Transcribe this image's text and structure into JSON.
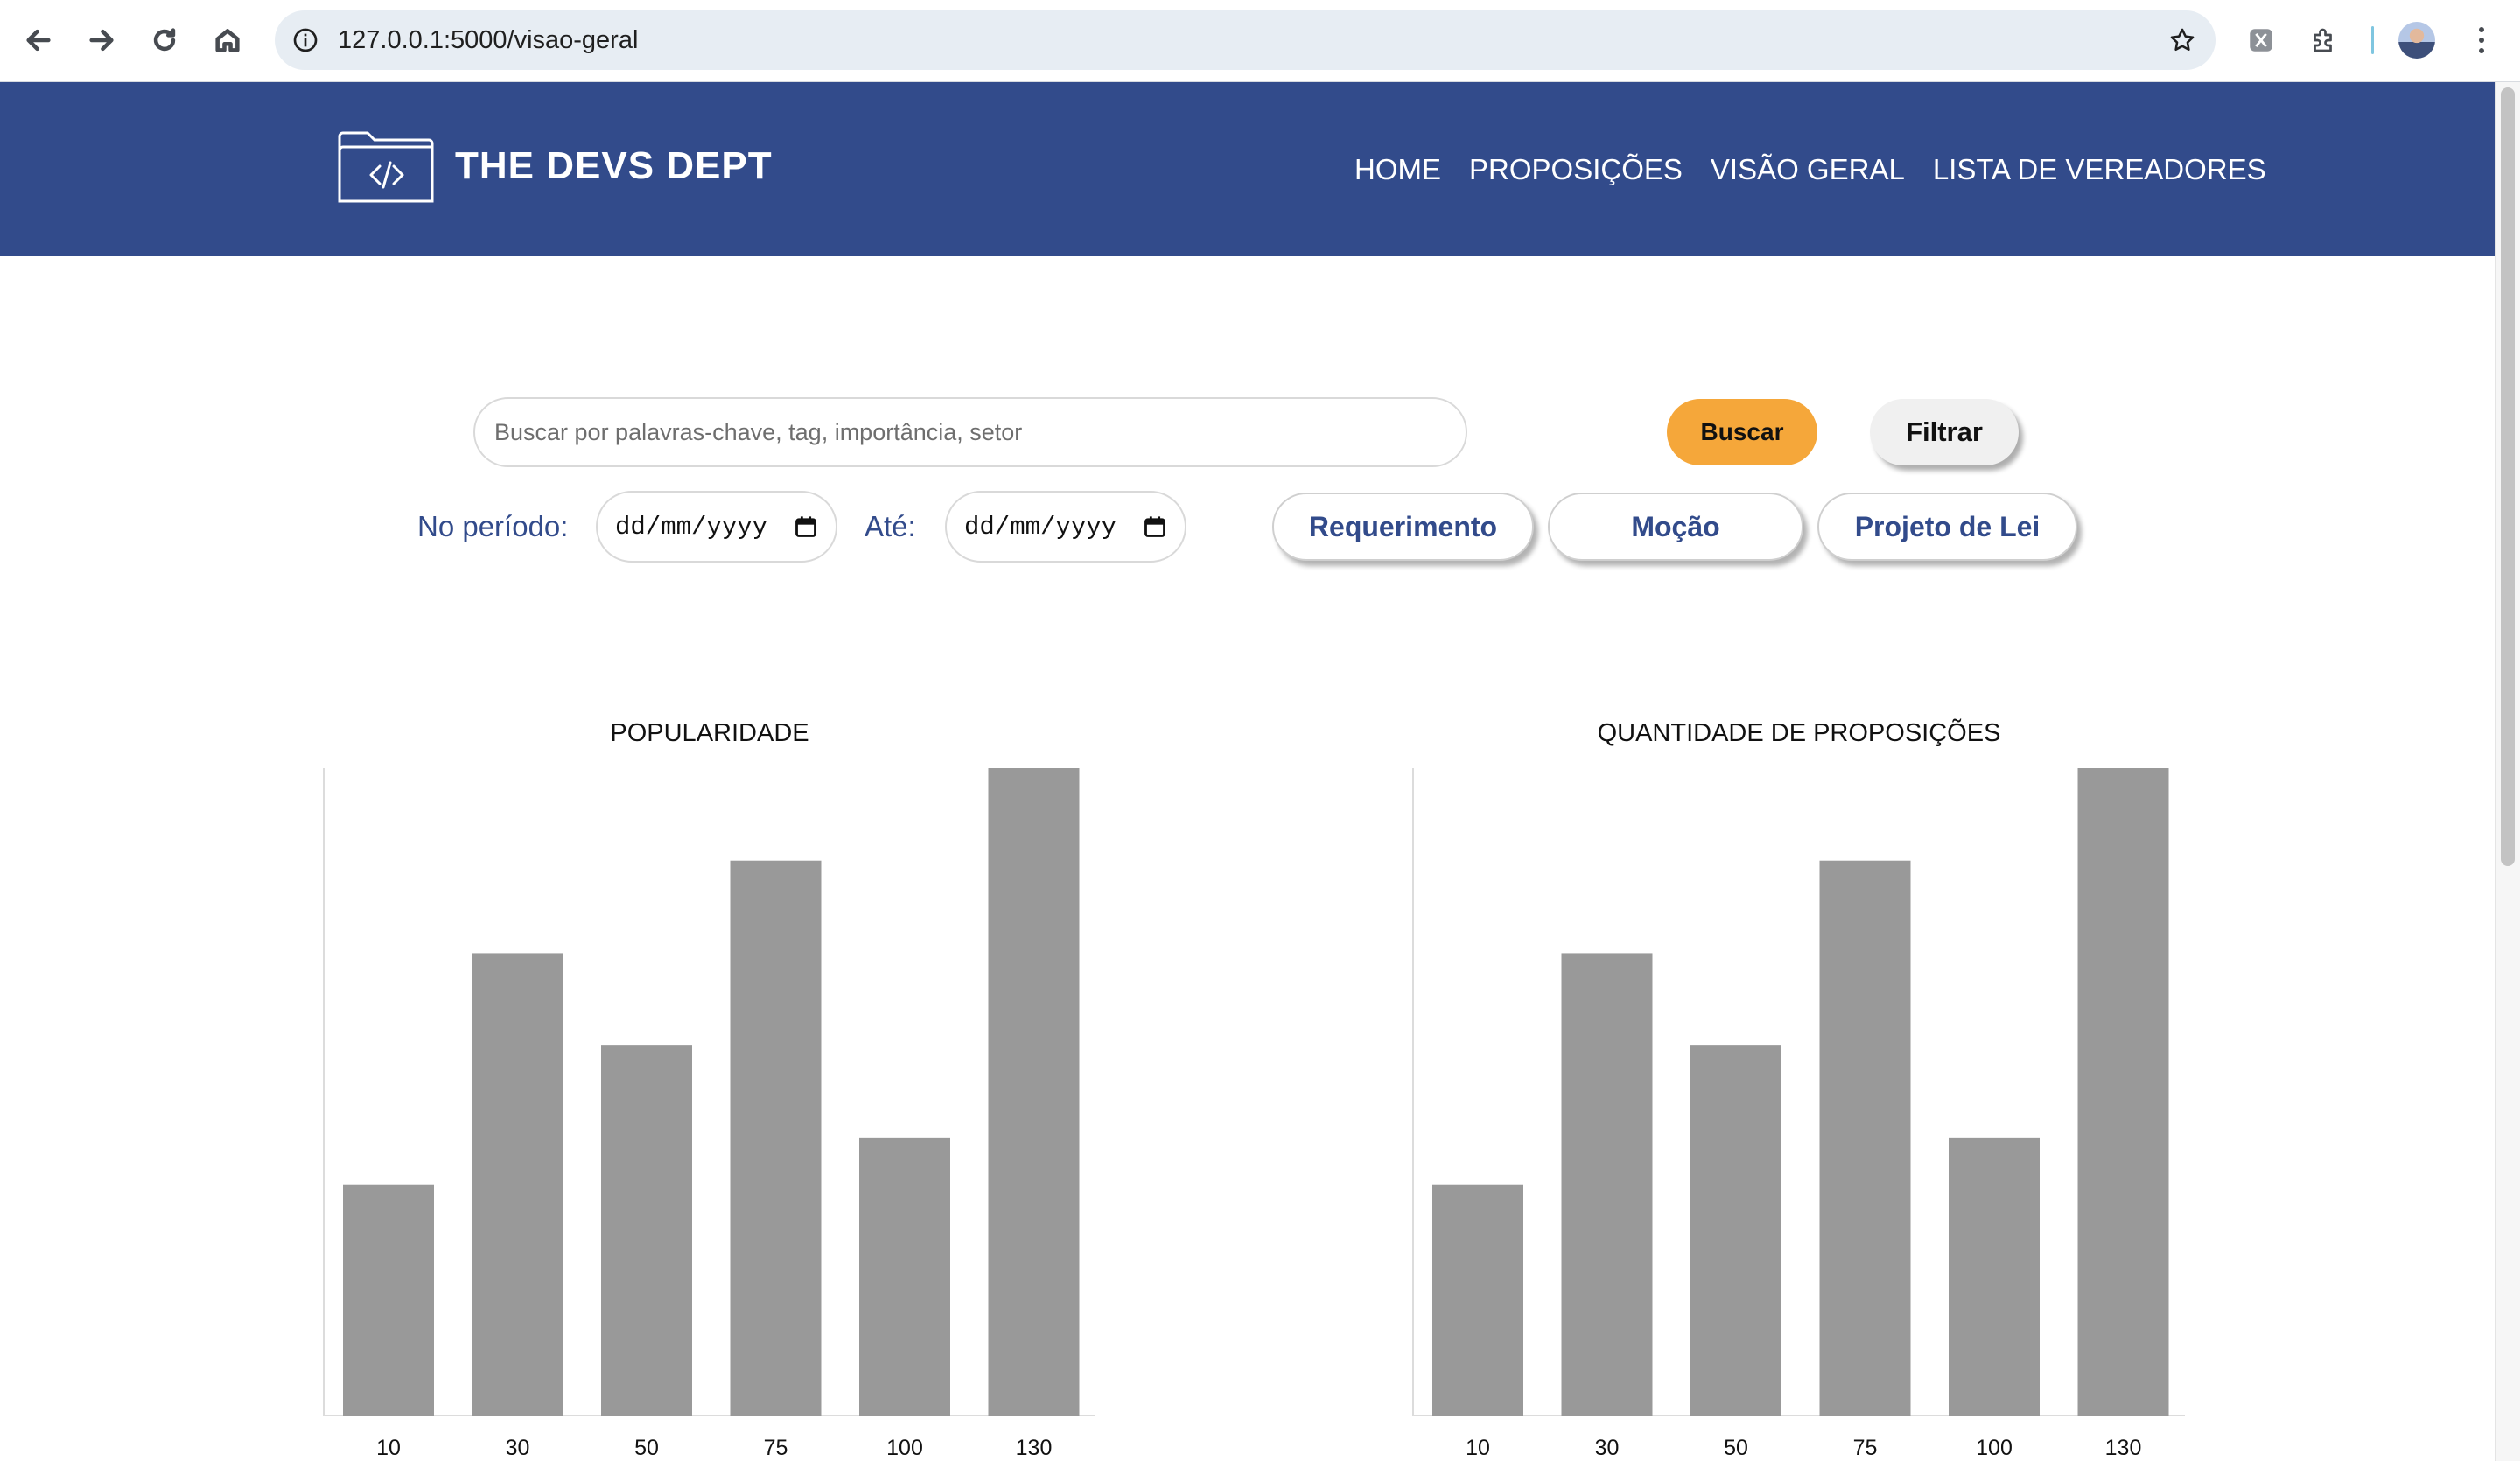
{
  "browser": {
    "url": "127.0.0.1:5000/visao-geral"
  },
  "site": {
    "brand": "THE DEVS DEPT",
    "nav": [
      "HOME",
      "PROPOSIÇÕES",
      "VISÃO GERAL",
      "LISTA DE VEREADORES"
    ]
  },
  "search": {
    "placeholder": "Buscar por palavras-chave, tag, importância, setor",
    "value": "",
    "search_label": "Buscar",
    "filter_label": "Filtrar"
  },
  "period": {
    "from_label": "No período:",
    "from_value": "dd/mm/yyyy",
    "to_label": "Até:",
    "to_value": "dd/mm/yyyy"
  },
  "types": [
    "Requerimento",
    "Moção",
    "Projeto de Lei"
  ],
  "chart_data": [
    {
      "type": "bar",
      "title": "POPULARIDADE",
      "categories": [
        "10",
        "30",
        "50",
        "75",
        "100",
        "130"
      ],
      "values": [
        25,
        50,
        40,
        60,
        30,
        70
      ],
      "ylim": [
        0,
        70
      ],
      "bar_color": "#999999",
      "grid": false,
      "legend": "none"
    },
    {
      "type": "bar",
      "title": "QUANTIDADE DE PROPOSIÇÕES",
      "categories": [
        "10",
        "30",
        "50",
        "75",
        "100",
        "130"
      ],
      "values": [
        25,
        50,
        40,
        60,
        30,
        70
      ],
      "ylim": [
        0,
        70
      ],
      "bar_color": "#999999",
      "grid": false,
      "legend": "none"
    }
  ],
  "colors": {
    "header_bg": "#324b8b",
    "accent": "#f5a73a",
    "pill_text": "#324b8b"
  }
}
